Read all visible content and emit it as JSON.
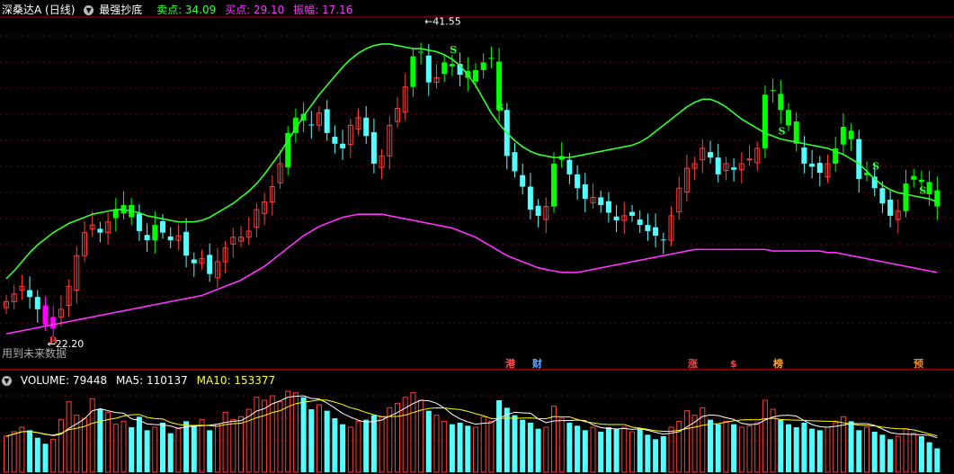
{
  "header": {
    "title": "深桑达A (日线)",
    "indicator": "最强抄底",
    "sell_label": "卖点: 34.09",
    "buy_label": "买点: 29.10",
    "amplitude_label": "振幅: 17.16"
  },
  "note": "用到未来数据",
  "badges": [
    {
      "text": "港",
      "color": "#ff5555"
    },
    {
      "text": "财",
      "color": "#66aaff"
    },
    {
      "text": "涨",
      "color": "#ff4444"
    },
    {
      "text": "$",
      "color": "#ff4444"
    },
    {
      "text": "榜",
      "color": "#ffaa33"
    },
    {
      "text": "预",
      "color": "#ff8800"
    }
  ],
  "volume_header": {
    "volume_label": "VOLUME: 79448",
    "ma5_label": "MA5: 110137",
    "ma10_label": "MA10: 153377"
  },
  "colors": {
    "up": "#ff3c3c",
    "down": "#54ffff",
    "sell_highlight": "#00ff00",
    "buy_highlight": "#ff00ff",
    "upper_line": "#33ff33",
    "lower_line": "#ff33ff",
    "ma5": "#ffffff",
    "ma10": "#ffff00",
    "grid": "#800000"
  },
  "chart_data": {
    "type": "candlestick",
    "price_high_label": "41.55",
    "price_low_label": "22.20",
    "closes": [
      24.0,
      24.5,
      25.0,
      24.3,
      23.5,
      22.5,
      23.0,
      23.5,
      25.0,
      27.0,
      28.5,
      29.0,
      28.5,
      29.2,
      30.0,
      30.3,
      29.5,
      28.6,
      28.0,
      29.0,
      28.5,
      28.0,
      28.3,
      27.0,
      26.5,
      26.8,
      25.8,
      26.6,
      27.5,
      28.2,
      28.2,
      28.6,
      30.0,
      30.5,
      31.5,
      33.0,
      35.0,
      36.0,
      35.8,
      35.5,
      36.3,
      35.0,
      34.3,
      34.0,
      35.5,
      36.0,
      34.8,
      33.0,
      33.5,
      35.5,
      36.6,
      38.0,
      40.0,
      40.3,
      38.3,
      38.6,
      39.6,
      39.5,
      38.8,
      38.6,
      39.1,
      39.6,
      39.9,
      36.5,
      33.5,
      32.5,
      31.5,
      30.0,
      29.6,
      30.2,
      33.0,
      33.5,
      32.3,
      31.4,
      30.7,
      30.8,
      30.3,
      29.8,
      29.3,
      29.6,
      29.6,
      29.0,
      28.6,
      28.3,
      28.0,
      29.6,
      31.4,
      32.7,
      33.0,
      34.0,
      33.4,
      32.3,
      33.0,
      32.6,
      33.0,
      33.3,
      34.0,
      37.5,
      37.8,
      36.5,
      35.5,
      34.3,
      33.0,
      32.8,
      32.4,
      33.0,
      34.0,
      35.4,
      34.6,
      32.0,
      32.4,
      31.4,
      30.4,
      29.6,
      29.9,
      31.7,
      32.2,
      31.8,
      31.0,
      30.2
    ],
    "upper_band": [
      25.5,
      26.0,
      26.6,
      27.2,
      27.7,
      28.1,
      28.5,
      28.8,
      29.1,
      29.3,
      29.5,
      29.7,
      29.8,
      29.9,
      30.0,
      30.0,
      29.9,
      29.8,
      29.6,
      29.5,
      29.4,
      29.3,
      29.2,
      29.2,
      29.2,
      29.3,
      29.5,
      29.8,
      30.1,
      30.4,
      30.8,
      31.2,
      31.7,
      32.3,
      33.0,
      33.7,
      34.5,
      35.3,
      36.1,
      36.8,
      37.5,
      38.1,
      38.7,
      39.3,
      39.8,
      40.2,
      40.5,
      40.7,
      40.8,
      40.8,
      40.7,
      40.6,
      40.5,
      40.5,
      40.4,
      40.3,
      40.1,
      39.8,
      39.4,
      38.8,
      38.1,
      37.2,
      36.3,
      35.6,
      35.0,
      34.5,
      34.1,
      33.8,
      33.6,
      33.5,
      33.4,
      33.4,
      33.4,
      33.5,
      33.6,
      33.7,
      33.8,
      33.9,
      34.0,
      34.1,
      34.2,
      34.4,
      34.7,
      35.1,
      35.5,
      35.9,
      36.3,
      36.7,
      37.0,
      37.2,
      37.2,
      37.0,
      36.7,
      36.3,
      35.9,
      35.6,
      35.3,
      35.0,
      34.8,
      34.6,
      34.5,
      34.4,
      34.3,
      34.2,
      34.1,
      34.0,
      33.8,
      33.6,
      33.3,
      33.0,
      32.5,
      32.0,
      31.6,
      31.3,
      31.1,
      31.0,
      30.9,
      30.8,
      30.7,
      30.5
    ],
    "lower_band": [
      21.9,
      22.0,
      22.1,
      22.2,
      22.3,
      22.4,
      22.5,
      22.6,
      22.7,
      22.8,
      22.9,
      23.0,
      23.1,
      23.2,
      23.3,
      23.4,
      23.5,
      23.6,
      23.7,
      23.8,
      23.9,
      24.0,
      24.1,
      24.2,
      24.3,
      24.4,
      24.6,
      24.8,
      25.0,
      25.2,
      25.4,
      25.7,
      26.0,
      26.3,
      26.7,
      27.1,
      27.5,
      27.9,
      28.3,
      28.6,
      28.9,
      29.1,
      29.3,
      29.5,
      29.6,
      29.7,
      29.7,
      29.7,
      29.7,
      29.6,
      29.5,
      29.4,
      29.3,
      29.2,
      29.1,
      29.0,
      28.9,
      28.8,
      28.6,
      28.4,
      28.2,
      27.9,
      27.6,
      27.3,
      27.0,
      26.8,
      26.6,
      26.4,
      26.2,
      26.1,
      26.0,
      25.9,
      25.9,
      25.9,
      26.0,
      26.1,
      26.2,
      26.3,
      26.4,
      26.5,
      26.6,
      26.7,
      26.8,
      26.9,
      27.0,
      27.1,
      27.2,
      27.3,
      27.4,
      27.4,
      27.4,
      27.4,
      27.4,
      27.4,
      27.4,
      27.4,
      27.4,
      27.4,
      27.3,
      27.3,
      27.3,
      27.3,
      27.3,
      27.3,
      27.3,
      27.2,
      27.2,
      27.1,
      27.0,
      26.9,
      26.8,
      26.7,
      26.6,
      26.5,
      26.4,
      26.3,
      26.2,
      26.1,
      26.0,
      25.9
    ],
    "volume": {
      "value": 79448,
      "ma5": 110137,
      "ma10": 153377,
      "bars": [
        120000,
        135000,
        150000,
        140000,
        115000,
        95000,
        110000,
        175000,
        235000,
        190000,
        180000,
        245000,
        210000,
        200000,
        160000,
        170000,
        150000,
        185000,
        140000,
        150000,
        165000,
        130000,
        145000,
        170000,
        155000,
        175000,
        140000,
        160000,
        200000,
        175000,
        185000,
        210000,
        250000,
        240000,
        255000,
        235000,
        270000,
        265000,
        250000,
        210000,
        225000,
        205000,
        180000,
        160000,
        150000,
        170000,
        175000,
        190000,
        185000,
        215000,
        230000,
        250000,
        265000,
        240000,
        205000,
        190000,
        170000,
        160000,
        165000,
        155000,
        150000,
        185000,
        170000,
        240000,
        215000,
        190000,
        175000,
        165000,
        145000,
        150000,
        220000,
        180000,
        165000,
        155000,
        140000,
        150000,
        135000,
        150000,
        145000,
        150000,
        135000,
        145000,
        125000,
        110000,
        120000,
        150000,
        170000,
        205000,
        190000,
        215000,
        175000,
        160000,
        170000,
        160000,
        150000,
        155000,
        165000,
        240000,
        210000,
        175000,
        160000,
        150000,
        165000,
        145000,
        140000,
        150000,
        165000,
        185000,
        170000,
        140000,
        150000,
        135000,
        125000,
        110000,
        120000,
        145000,
        130000,
        120000,
        100000,
        79448
      ]
    }
  }
}
